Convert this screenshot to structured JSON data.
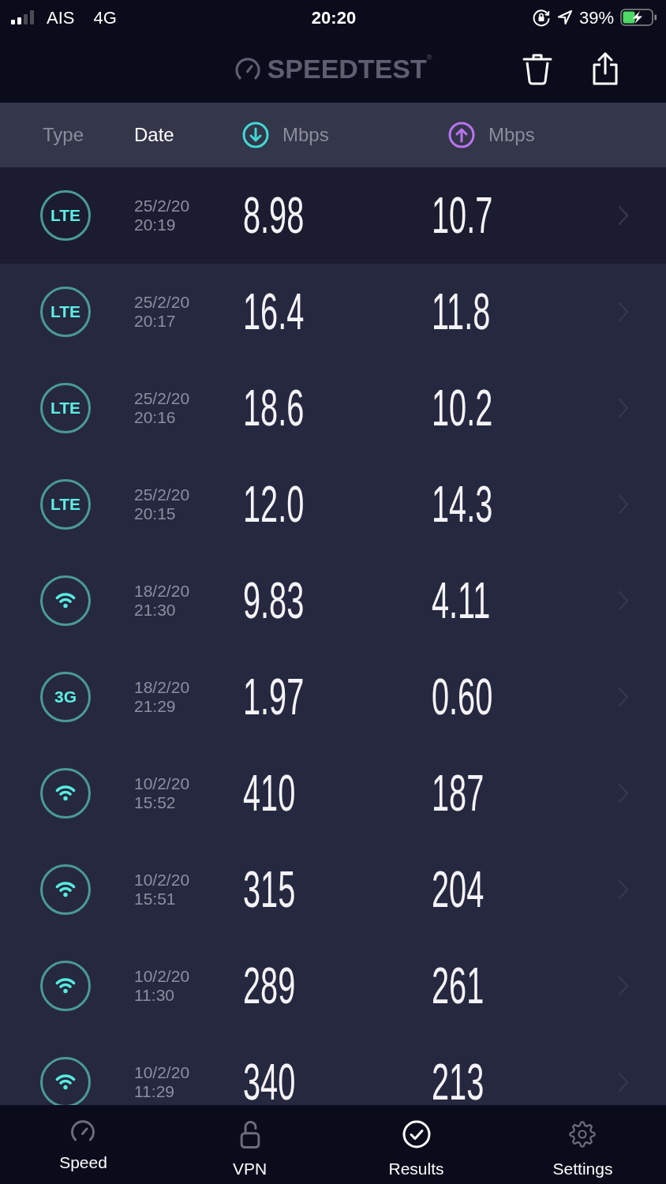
{
  "status_bar": {
    "carrier": "AIS",
    "network": "4G",
    "time": "20:20",
    "battery": "39%"
  },
  "header": {
    "logo": "SPEEDTEST$^{®}$"
  },
  "columns": [
    {
      "kind": "text",
      "label": "Type",
      "selected": false
    },
    {
      "kind": "text",
      "label": "Date",
      "selected": true
    },
    {
      "kind": "download",
      "label": "Mbps",
      "selected": false
    },
    {
      "kind": "upload",
      "label": "Mbps",
      "selected": false
    }
  ],
  "results": [
    {
      "kind": "cellular",
      "label": "LTE",
      "date": "25/2/20",
      "time": "20:19",
      "download": "8.98",
      "upload": "10.7",
      "selected": true
    },
    {
      "kind": "cellular",
      "label": "LTE",
      "date": "25/2/20",
      "time": "20:17",
      "download": "16.4",
      "upload": "11.8",
      "selected": false
    },
    {
      "kind": "cellular",
      "label": "LTE",
      "date": "25/2/20",
      "time": "20:16",
      "download": "18.6",
      "upload": "10.2",
      "selected": false
    },
    {
      "kind": "cellular",
      "label": "LTE",
      "date": "25/2/20",
      "time": "20:15",
      "download": "12.0",
      "upload": "14.3",
      "selected": false
    },
    {
      "kind": "wifi",
      "date": "18/2/20",
      "time": "21:30",
      "download": "9.83",
      "upload": "4.11",
      "selected": false
    },
    {
      "kind": "cellular",
      "label": "3G",
      "date": "18/2/20",
      "time": "21:29",
      "download": "1.97",
      "upload": "0.60",
      "selected": false
    },
    {
      "kind": "wifi",
      "date": "10/2/20",
      "time": "15:52",
      "download": "410",
      "upload": "187",
      "selected": false
    },
    {
      "kind": "wifi",
      "date": "10/2/20",
      "time": "15:51",
      "download": "315",
      "upload": "204",
      "selected": false
    },
    {
      "kind": "wifi",
      "date": "10/2/20",
      "time": "11:30",
      "download": "289",
      "upload": "261",
      "selected": false
    },
    {
      "kind": "wifi",
      "date": "10/2/20",
      "time": "11:29",
      "download": "340",
      "upload": "213",
      "selected": false
    }
  ],
  "tabs": [
    {
      "label": "Speed",
      "selected": false
    },
    {
      "label": "VPN",
      "selected": false
    },
    {
      "label": "Results",
      "selected": true
    },
    {
      "label": "Settings",
      "selected": false
    }
  ]
}
